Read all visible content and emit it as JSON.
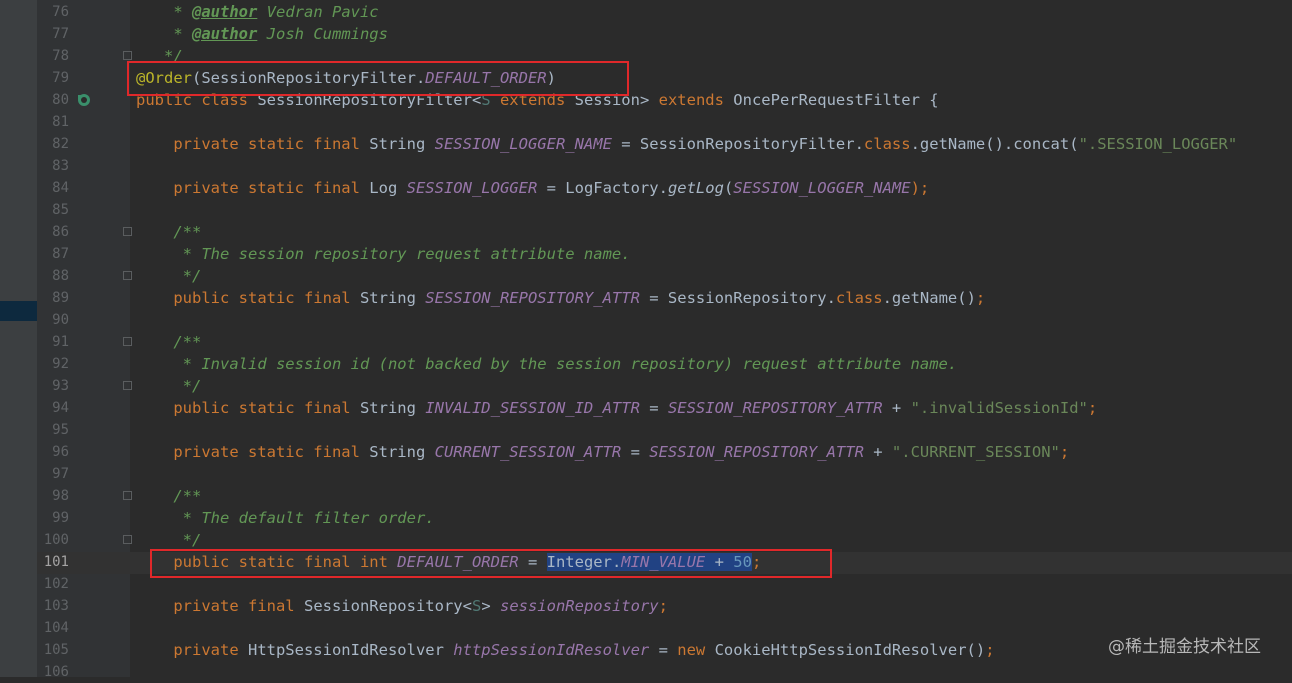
{
  "watermark": "@稀土掘金技术社区",
  "lines": [
    {
      "n": "76",
      "tokens": [
        {
          "t": "    * ",
          "c": "t-com"
        },
        {
          "t": "@author",
          "c": "t-tag"
        },
        {
          "t": " Vedran Pavic",
          "c": "t-com"
        }
      ]
    },
    {
      "n": "77",
      "tokens": [
        {
          "t": "    * ",
          "c": "t-com"
        },
        {
          "t": "@author",
          "c": "t-tag"
        },
        {
          "t": " Josh Cummings",
          "c": "t-com"
        }
      ]
    },
    {
      "n": "78",
      "fold": true,
      "tokens": [
        {
          "t": "   */",
          "c": "t-com"
        }
      ]
    },
    {
      "n": "79",
      "tokens": [
        {
          "t": "@Order",
          "c": "t-ann"
        },
        {
          "t": "(SessionRepositoryFilter.",
          "c": "t-plain"
        },
        {
          "t": "DEFAULT_ORDER",
          "c": "t-field"
        },
        {
          "t": ")",
          "c": "t-plain"
        }
      ]
    },
    {
      "n": "80",
      "tokens": [
        {
          "t": "public class ",
          "c": "t-kw"
        },
        {
          "t": "SessionRepositoryFilter<",
          "c": "t-plain"
        },
        {
          "t": "S ",
          "c": "t-generic"
        },
        {
          "t": "extends ",
          "c": "t-kw"
        },
        {
          "t": "Session> ",
          "c": "t-plain"
        },
        {
          "t": "extends ",
          "c": "t-kw"
        },
        {
          "t": "OncePerRequestFilter {",
          "c": "t-plain"
        }
      ]
    },
    {
      "n": "81",
      "tokens": []
    },
    {
      "n": "82",
      "tokens": [
        {
          "t": "    private static final ",
          "c": "t-kw"
        },
        {
          "t": "String ",
          "c": "t-plain"
        },
        {
          "t": "SESSION_LOGGER_NAME",
          "c": "t-field"
        },
        {
          "t": " = SessionRepositoryFilter.",
          "c": "t-plain"
        },
        {
          "t": "class",
          "c": "t-kw"
        },
        {
          "t": ".getName().concat(",
          "c": "t-plain"
        },
        {
          "t": "\".SESSION_LOGGER\"",
          "c": "t-str"
        }
      ]
    },
    {
      "n": "83",
      "tokens": []
    },
    {
      "n": "84",
      "tokens": [
        {
          "t": "    private static final ",
          "c": "t-kw"
        },
        {
          "t": "Log ",
          "c": "t-plain"
        },
        {
          "t": "SESSION_LOGGER",
          "c": "t-field"
        },
        {
          "t": " = LogFactory.",
          "c": "t-plain"
        },
        {
          "t": "getLog",
          "c": "t-method-s"
        },
        {
          "t": "(",
          "c": "t-plain"
        },
        {
          "t": "SESSION_LOGGER_NAME",
          "c": "t-field"
        },
        {
          "t": ");",
          "c": "t-kw"
        }
      ]
    },
    {
      "n": "85",
      "tokens": []
    },
    {
      "n": "86",
      "fold": true,
      "tokens": [
        {
          "t": "    /**",
          "c": "t-com"
        }
      ]
    },
    {
      "n": "87",
      "tokens": [
        {
          "t": "     * The session repository request attribute name.",
          "c": "t-com"
        }
      ]
    },
    {
      "n": "88",
      "fold": true,
      "tokens": [
        {
          "t": "     */",
          "c": "t-com"
        }
      ]
    },
    {
      "n": "89",
      "tokens": [
        {
          "t": "    public static final ",
          "c": "t-kw"
        },
        {
          "t": "String ",
          "c": "t-plain"
        },
        {
          "t": "SESSION_REPOSITORY_ATTR",
          "c": "t-field"
        },
        {
          "t": " = SessionRepository.",
          "c": "t-plain"
        },
        {
          "t": "class",
          "c": "t-kw"
        },
        {
          "t": ".getName()",
          "c": "t-plain"
        },
        {
          "t": ";",
          "c": "t-kw"
        }
      ]
    },
    {
      "n": "90",
      "tokens": []
    },
    {
      "n": "91",
      "fold": true,
      "tokens": [
        {
          "t": "    /**",
          "c": "t-com"
        }
      ]
    },
    {
      "n": "92",
      "tokens": [
        {
          "t": "     * Invalid session id (not backed by the session repository) request attribute name.",
          "c": "t-com"
        }
      ]
    },
    {
      "n": "93",
      "fold": true,
      "tokens": [
        {
          "t": "     */",
          "c": "t-com"
        }
      ]
    },
    {
      "n": "94",
      "tokens": [
        {
          "t": "    public static final ",
          "c": "t-kw"
        },
        {
          "t": "String ",
          "c": "t-plain"
        },
        {
          "t": "INVALID_SESSION_ID_ATTR",
          "c": "t-field"
        },
        {
          "t": " = ",
          "c": "t-plain"
        },
        {
          "t": "SESSION_REPOSITORY_ATTR",
          "c": "t-field"
        },
        {
          "t": " + ",
          "c": "t-plain"
        },
        {
          "t": "\".invalidSessionId\"",
          "c": "t-str"
        },
        {
          "t": ";",
          "c": "t-kw"
        }
      ]
    },
    {
      "n": "95",
      "tokens": []
    },
    {
      "n": "96",
      "tokens": [
        {
          "t": "    private static final ",
          "c": "t-kw"
        },
        {
          "t": "String ",
          "c": "t-plain"
        },
        {
          "t": "CURRENT_SESSION_ATTR",
          "c": "t-field"
        },
        {
          "t": " = ",
          "c": "t-plain"
        },
        {
          "t": "SESSION_REPOSITORY_ATTR",
          "c": "t-field"
        },
        {
          "t": " + ",
          "c": "t-plain"
        },
        {
          "t": "\".CURRENT_SESSION\"",
          "c": "t-str"
        },
        {
          "t": ";",
          "c": "t-kw"
        }
      ]
    },
    {
      "n": "97",
      "tokens": []
    },
    {
      "n": "98",
      "fold": true,
      "tokens": [
        {
          "t": "    /**",
          "c": "t-com"
        }
      ]
    },
    {
      "n": "99",
      "tokens": [
        {
          "t": "     * The default filter order.",
          "c": "t-com"
        }
      ]
    },
    {
      "n": "100",
      "fold": true,
      "tokens": [
        {
          "t": "     */",
          "c": "t-com"
        }
      ]
    },
    {
      "n": "101",
      "current": true,
      "tokens": [
        {
          "t": "    public static final int ",
          "c": "t-kw"
        },
        {
          "t": "DEFAULT_ORDER",
          "c": "t-field"
        },
        {
          "t": " = ",
          "c": "t-plain"
        },
        {
          "t": "Integer.",
          "c": "t-plain t-sel"
        },
        {
          "t": "MIN_VALUE",
          "c": "t-field t-sel"
        },
        {
          "t": " + ",
          "c": "t-plain t-sel"
        },
        {
          "t": "50",
          "c": "t-num t-sel"
        },
        {
          "t": ";",
          "c": "t-kw"
        }
      ]
    },
    {
      "n": "102",
      "tokens": []
    },
    {
      "n": "103",
      "tokens": [
        {
          "t": "    private final ",
          "c": "t-kw"
        },
        {
          "t": "SessionRepository<",
          "c": "t-plain"
        },
        {
          "t": "S",
          "c": "t-generic"
        },
        {
          "t": "> ",
          "c": "t-plain"
        },
        {
          "t": "sessionRepository",
          "c": "t-field"
        },
        {
          "t": ";",
          "c": "t-kw"
        }
      ]
    },
    {
      "n": "104",
      "tokens": []
    },
    {
      "n": "105",
      "tokens": [
        {
          "t": "    private ",
          "c": "t-kw"
        },
        {
          "t": "HttpSessionIdResolver ",
          "c": "t-plain"
        },
        {
          "t": "httpSessionIdResolver",
          "c": "t-field"
        },
        {
          "t": " = ",
          "c": "t-plain"
        },
        {
          "t": "new ",
          "c": "t-kw"
        },
        {
          "t": "CookieHttpSessionIdResolver()",
          "c": "t-plain"
        },
        {
          "t": ";",
          "c": "t-kw"
        }
      ]
    },
    {
      "n": "106",
      "tokens": []
    }
  ]
}
